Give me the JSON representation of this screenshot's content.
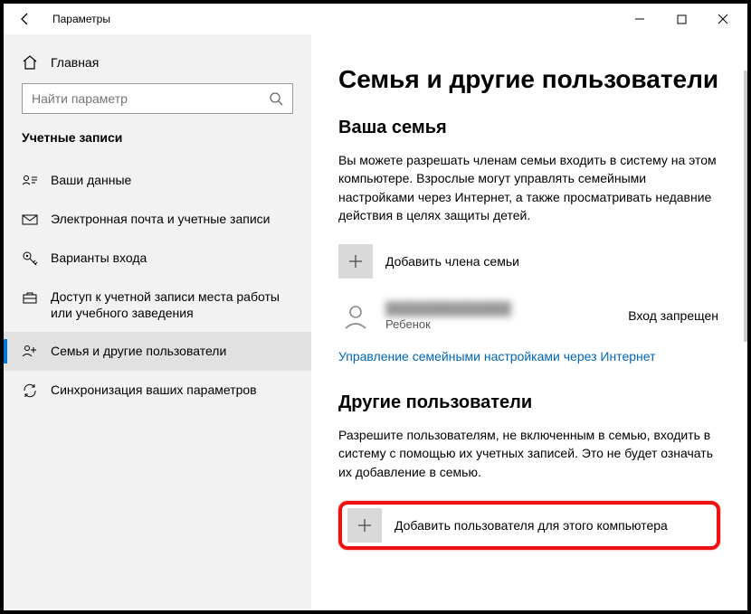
{
  "titlebar": {
    "title": "Параметры"
  },
  "sidebar": {
    "home": "Главная",
    "search_placeholder": "Найти параметр",
    "category": "Учетные записи",
    "items": [
      {
        "label": "Ваши данные"
      },
      {
        "label": "Электронная почта и учетные записи"
      },
      {
        "label": "Варианты входа"
      },
      {
        "label": "Доступ к учетной записи места работы или учебного заведения"
      },
      {
        "label": "Семья и другие пользователи"
      },
      {
        "label": "Синхронизация ваших параметров"
      }
    ]
  },
  "main": {
    "title": "Семья и другие пользователи",
    "family": {
      "heading": "Ваша семья",
      "desc": "Вы можете разрешать членам семьи входить в систему на этом компьютере. Взрослые могут управлять семейными настройками через Интернет, а также просматривать недавние действия в целях защиты детей.",
      "add": "Добавить члена семьи",
      "member": {
        "name": "██████████████",
        "role": "Ребенок",
        "status": "Вход запрещен"
      },
      "manage_link": "Управление семейными настройками через Интернет"
    },
    "others": {
      "heading": "Другие пользователи",
      "desc": "Разрешите пользователям, не включенным в семью, входить в систему с помощью их учетных записей. Это не будет означать их добавление в семью.",
      "add": "Добавить пользователя для этого компьютера"
    }
  }
}
